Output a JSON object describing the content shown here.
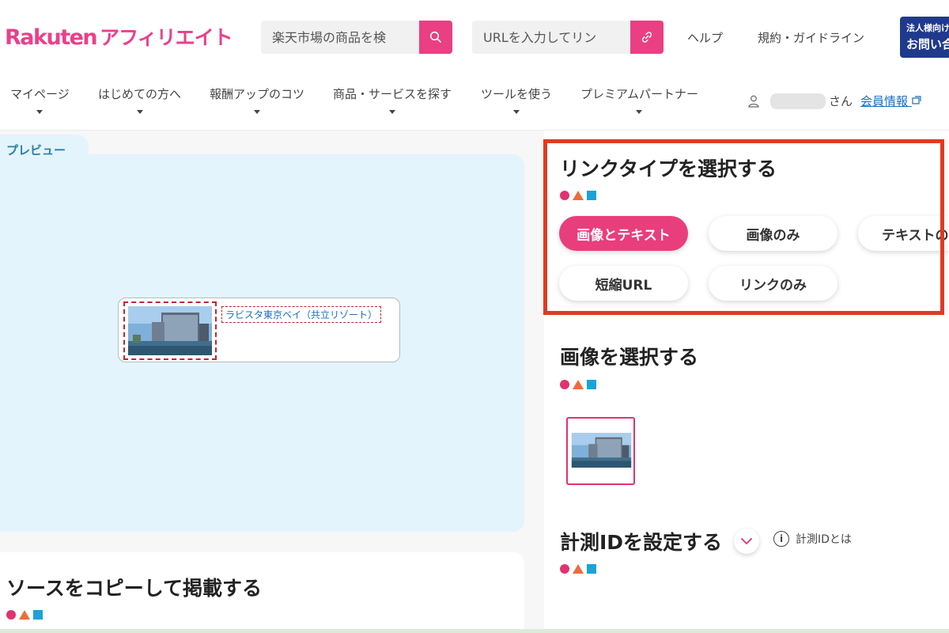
{
  "header": {
    "logo": {
      "rakuten": "Rakuten",
      "affiliate": "アフィリエイト"
    },
    "search_products": {
      "placeholder": "楽天市場の商品を検"
    },
    "search_url": {
      "placeholder": "URLを入力してリン"
    },
    "help": "ヘルプ",
    "guidelines": "規約・ガイドライン",
    "corporate": {
      "line1": "法人様向け",
      "line2": "お問い合"
    }
  },
  "nav": {
    "items": [
      {
        "label": "マイページ"
      },
      {
        "label": "はじめての方へ"
      },
      {
        "label": "報酬アップのコツ"
      },
      {
        "label": "商品・サービスを探す"
      },
      {
        "label": "ツールを使う"
      },
      {
        "label": "プレミアムパートナー"
      }
    ],
    "user_suffix": "さん",
    "member_info": "会員情報"
  },
  "preview": {
    "tab_label": "プレビュー",
    "card_link_text": "ラビスタ東京ベイ（共立リゾート）"
  },
  "link_type": {
    "title": "リンクタイプを選択する",
    "options": [
      {
        "label": "画像とテキスト",
        "selected": true
      },
      {
        "label": "画像のみ",
        "selected": false
      },
      {
        "label": "テキストの",
        "selected": false
      },
      {
        "label": "短縮URL",
        "selected": false
      },
      {
        "label": "リンクのみ",
        "selected": false
      }
    ]
  },
  "image_select": {
    "title": "画像を選択する"
  },
  "tracking": {
    "title": "計測IDを設定する",
    "info_label": "計測IDとは"
  },
  "source": {
    "title": "ソースをコピーして掲載する"
  },
  "colors": {
    "brand_pink": "#e83e7c",
    "highlight_red": "#e13a23",
    "preview_bg": "#e3f4fc",
    "link_blue": "#1a6fc2"
  }
}
